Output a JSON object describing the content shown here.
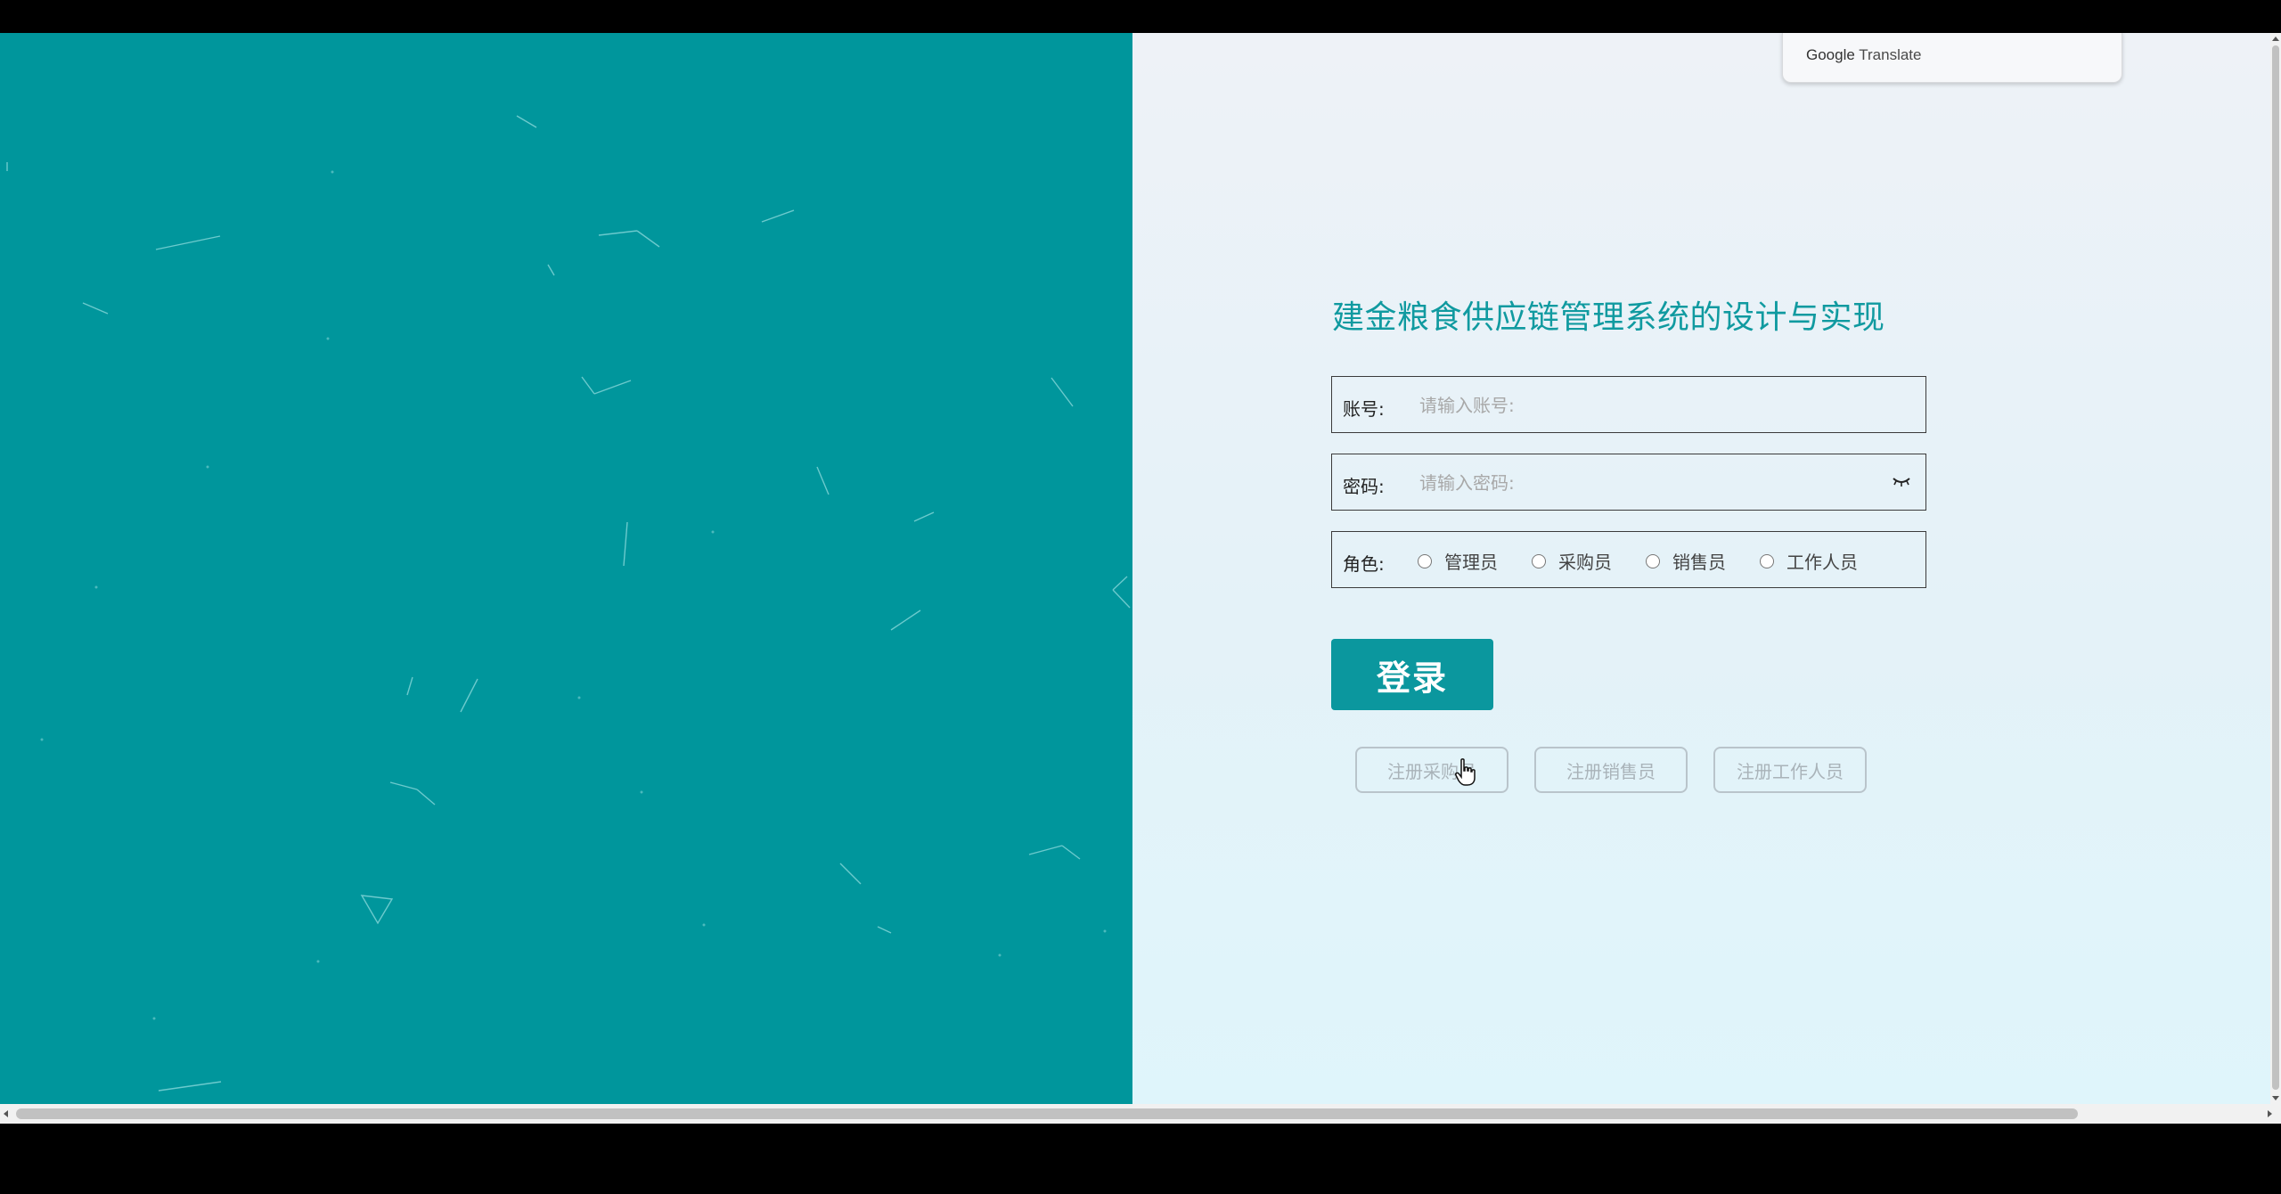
{
  "google_translate": {
    "brand": "Google",
    "label": "Translate"
  },
  "title": "建金粮食供应链管理系统的设计与实现",
  "form": {
    "account": {
      "label": "账号:",
      "placeholder": "请输入账号:"
    },
    "password": {
      "label": "密码:",
      "placeholder": "请输入密码:"
    },
    "role": {
      "label": "角色:",
      "options": [
        "管理员",
        "采购员",
        "销售员",
        "工作人员"
      ]
    },
    "login_label": "登录"
  },
  "register": {
    "purchaser": "注册采购员",
    "seller": "注册销售员",
    "staff": "注册工作人员"
  },
  "colors": {
    "brand_teal": "#00969c",
    "button_teal": "#0b979e",
    "title_teal": "#109aa0"
  },
  "icons": {
    "password_toggle": "eye-closed-icon",
    "cursor": "hand-pointer-icon"
  }
}
